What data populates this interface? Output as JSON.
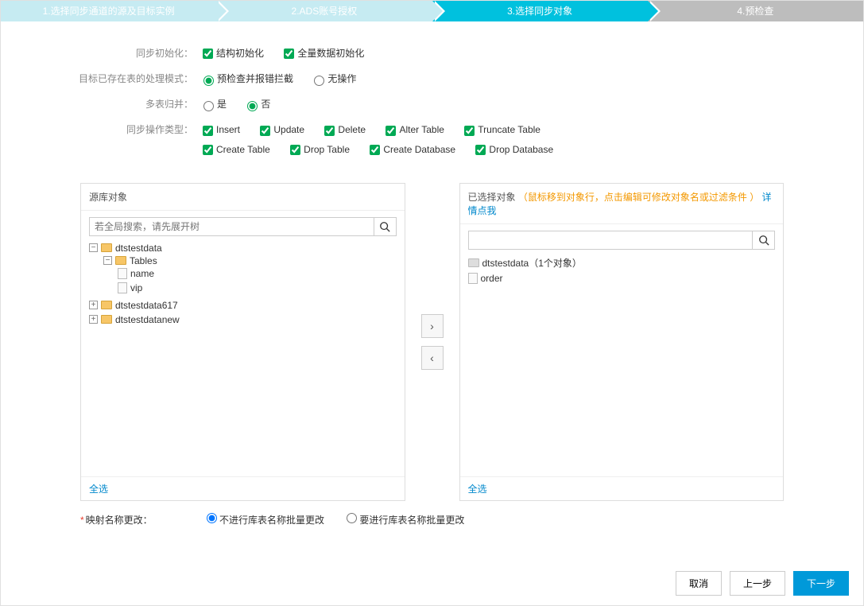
{
  "steps": {
    "s1": "1.选择同步通道的源及目标实例",
    "s2": "2.ADS账号授权",
    "s3": "3.选择同步对象",
    "s4": "4.预检查"
  },
  "form": {
    "init_label": "同步初始化：",
    "init_struct": "结构初始化",
    "init_full": "全量数据初始化",
    "exist_label": "目标已存在表的处理模式：",
    "exist_precheck": "预检查并报错拦截",
    "exist_noop": "无操作",
    "merge_label": "多表归并：",
    "merge_yes": "是",
    "merge_no": "否",
    "op_label": "同步操作类型：",
    "ops": {
      "insert": "Insert",
      "update": "Update",
      "delete": "Delete",
      "alter": "Alter Table",
      "truncate": "Truncate Table",
      "create_table": "Create Table",
      "drop_table": "Drop Table",
      "create_db": "Create Database",
      "drop_db": "Drop Database"
    }
  },
  "source_panel": {
    "title": "源库对象",
    "search_placeholder": "若全局搜索，请先展开树",
    "select_all": "全选"
  },
  "target_panel": {
    "title": "已选择对象",
    "hint": "（鼠标移到对象行，点击编辑可修改对象名或过滤条件 ）",
    "detail_link": "详情点我",
    "select_all": "全选"
  },
  "tree_source": {
    "db1": "dtstestdata",
    "tables_label": "Tables",
    "t_name": "name",
    "t_vip": "vip",
    "db2": "dtstestdata617",
    "db3": "dtstestdatanew"
  },
  "tree_target": {
    "db": "dtstestdata（1个对象）",
    "item": "order"
  },
  "mapping": {
    "label": "映射名称更改：",
    "no_change": "不进行库表名称批量更改",
    "do_change": "要进行库表名称批量更改"
  },
  "footer": {
    "cancel": "取消",
    "prev": "上一步",
    "next": "下一步"
  }
}
